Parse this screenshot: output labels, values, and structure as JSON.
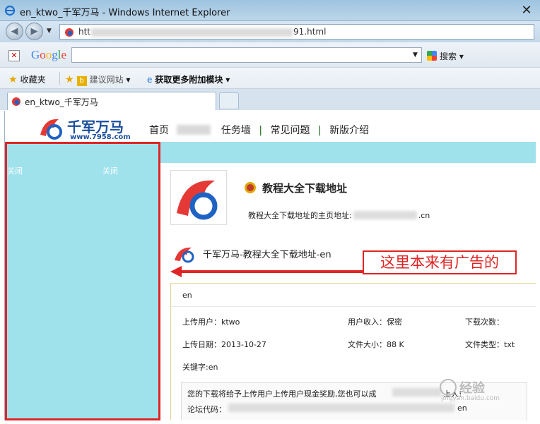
{
  "window": {
    "title": "en_ktwo_千军万马 - Windows Internet Explorer",
    "close_glyph": "✕"
  },
  "address": {
    "prefix": "htt",
    "suffix": "91.html"
  },
  "google": {
    "logo": "Google",
    "search_label": "搜索"
  },
  "favorites": {
    "label": "收藏夹",
    "suggested": "建议网站",
    "addons": "获取更多附加模块"
  },
  "tab": {
    "label": "en_ktwo_千军万马"
  },
  "site": {
    "name": "千军万马",
    "url": "www.7958.com",
    "nav": {
      "home": "首页",
      "tasks": "任务墙",
      "faq": "常见问题",
      "new": "新版介绍",
      "sep": "|"
    }
  },
  "left_panel": {
    "close1": "关闭",
    "close2": "关闭"
  },
  "profile": {
    "title": "教程大全下载地址",
    "home_prefix": "教程大全下载地址的主页地址:",
    "home_suffix": ".cn"
  },
  "download": {
    "title": "千军万马-教程大全下载地址-en"
  },
  "callout": {
    "text": "这里本来有广告的"
  },
  "info": {
    "tag": "en",
    "uploader": "上传用户：ktwo",
    "income": "用户收入：保密",
    "downloads": "下载次数：",
    "date": "上传日期：2013-10-27",
    "size": "文件大小：88 K",
    "type": "文件类型：txt",
    "keywords": "关键字:en",
    "notice_line1": "您的下载将给予上传用户上传用户现金奖励,您也可以成",
    "notice_line1b": "上人!",
    "notice_line2": "论坛代码：",
    "notice_line2b": "en"
  },
  "watermark": {
    "text": "经验",
    "sub": "jingyan.baidu.com"
  }
}
